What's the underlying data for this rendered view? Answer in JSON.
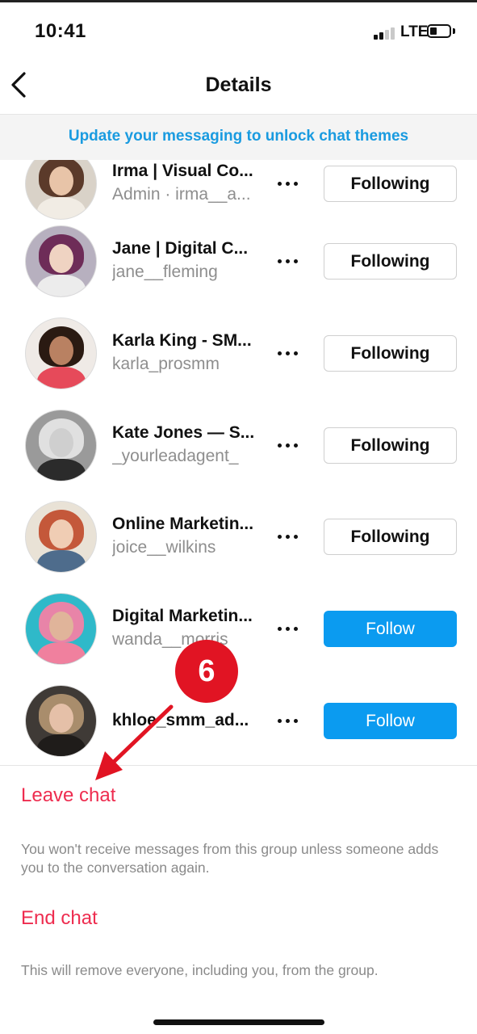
{
  "status_bar": {
    "time": "10:41",
    "network": "LTE",
    "signal_bars": 2,
    "battery_level": 0.3
  },
  "nav": {
    "title": "Details",
    "back_icon": "chevron-left-icon"
  },
  "banner": {
    "text": "Update your messaging to unlock chat themes",
    "color": "#1a9be0"
  },
  "members": [
    {
      "name": "Irma | Visual Co...",
      "handle": "Admin · irma__a...",
      "button": "Following",
      "button_style": "following",
      "more_icon": "more-horizontal-icon",
      "colors": {
        "bg": "#d9d2c8",
        "hair": "#5b3a2a",
        "face": "#e8c4a8",
        "body": "#f1ece4"
      }
    },
    {
      "name": "Jane | Digital C...",
      "handle": "jane__fleming",
      "button": "Following",
      "button_style": "following",
      "more_icon": "more-horizontal-icon",
      "colors": {
        "bg": "#b7b0bf",
        "hair": "#6e2c58",
        "face": "#efd3c2",
        "body": "#ececec"
      }
    },
    {
      "name": "Karla King - SM...",
      "handle": "karla_prosmm",
      "button": "Following",
      "button_style": "following",
      "more_icon": "more-horizontal-icon",
      "colors": {
        "bg": "#efeae6",
        "hair": "#2a1a12",
        "face": "#b98162",
        "body": "#e64a5a"
      }
    },
    {
      "name": "Kate Jones — S...",
      "handle": "_yourleadagent_",
      "button": "Following",
      "button_style": "following",
      "more_icon": "more-horizontal-icon",
      "colors": {
        "bg": "#9a9a9a",
        "hair": "#e0e0e0",
        "face": "#cfcfcf",
        "body": "#2b2b2b"
      }
    },
    {
      "name": "Online Marketin...",
      "handle": "joice__wilkins",
      "button": "Following",
      "button_style": "following",
      "more_icon": "more-horizontal-icon",
      "colors": {
        "bg": "#e9e2d6",
        "hair": "#c4583a",
        "face": "#f0cdb4",
        "body": "#4e6c8c"
      }
    },
    {
      "name": "Digital Marketin...",
      "handle": "wanda__morris",
      "button": "Follow",
      "button_style": "follow",
      "more_icon": "more-horizontal-icon",
      "colors": {
        "bg": "#2fb9c9",
        "hair": "#e884a8",
        "face": "#e0b49a",
        "body": "#f0809e"
      }
    },
    {
      "name": "khloe_smm_ad...",
      "handle": "",
      "button": "Follow",
      "button_style": "follow",
      "more_icon": "more-horizontal-icon",
      "colors": {
        "bg": "#3f3a36",
        "hair": "#a98d6c",
        "face": "#e5c0a8",
        "body": "#1f1c1a"
      }
    }
  ],
  "leave_chat": {
    "label": "Leave chat",
    "note": "You won't receive messages from this group unless someone adds you to the conversation again."
  },
  "end_chat": {
    "label": "End chat",
    "note": "This will remove everyone, including you, from the group."
  },
  "annotation": {
    "step": "6",
    "color": "#e11423"
  },
  "colors": {
    "destructive": "#ee2c4f",
    "follow_button": "#0b9bf0",
    "secondary_text": "#8e8e8e"
  }
}
